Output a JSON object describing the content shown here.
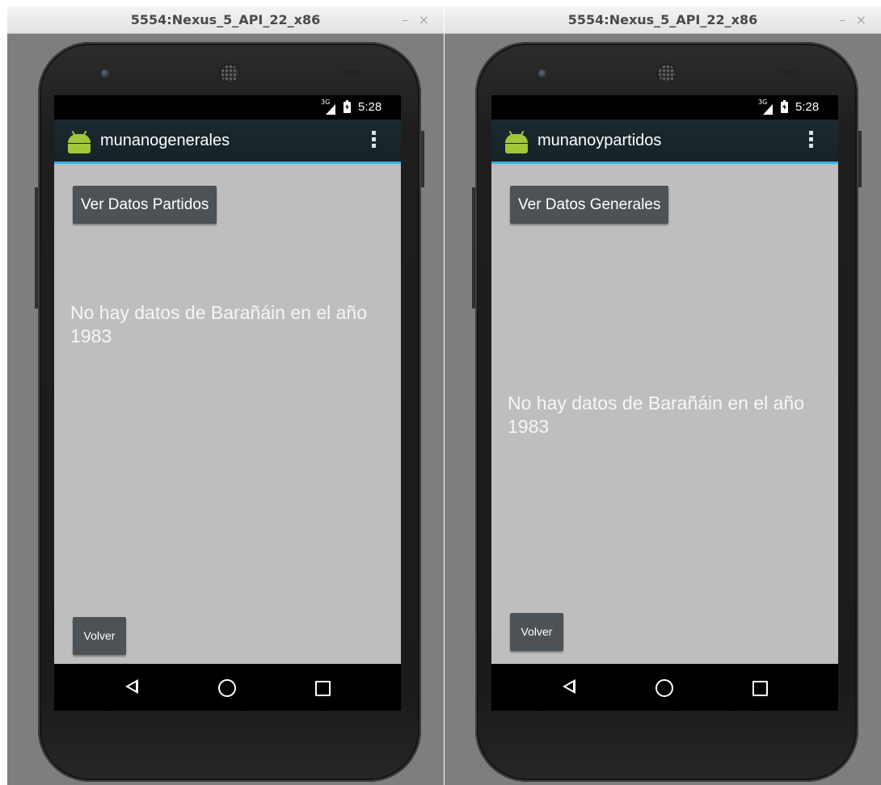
{
  "windows": [
    {
      "title": "5554:Nexus_5_API_22_x86",
      "minimize_label": "–",
      "close_label": "×",
      "status": {
        "network": "3G",
        "time": "5:28"
      },
      "app_title": "munanogenerales",
      "top_button": "Ver Datos Partidos",
      "message": "No hay datos de Barañáin en el año 1983",
      "back_button": "Volver"
    },
    {
      "title": "5554:Nexus_5_API_22_x86",
      "minimize_label": "–",
      "close_label": "×",
      "status": {
        "network": "3G",
        "time": "5:28"
      },
      "app_title": "munanoypartidos",
      "top_button": "Ver Datos Generales",
      "message": "No hay datos de Barañáin en el año 1983",
      "back_button": "Volver"
    }
  ],
  "colors": {
    "action_bar": "#162328",
    "action_bar_accent": "#33b5e5",
    "content_background": "#bebebe",
    "button": "#4c5256",
    "android_green": "#a4c639"
  },
  "icons": [
    "android-logo-icon",
    "overflow-menu-icon",
    "signal-icon",
    "battery-icon",
    "nav-back-icon",
    "nav-home-icon",
    "nav-recents-icon"
  ]
}
